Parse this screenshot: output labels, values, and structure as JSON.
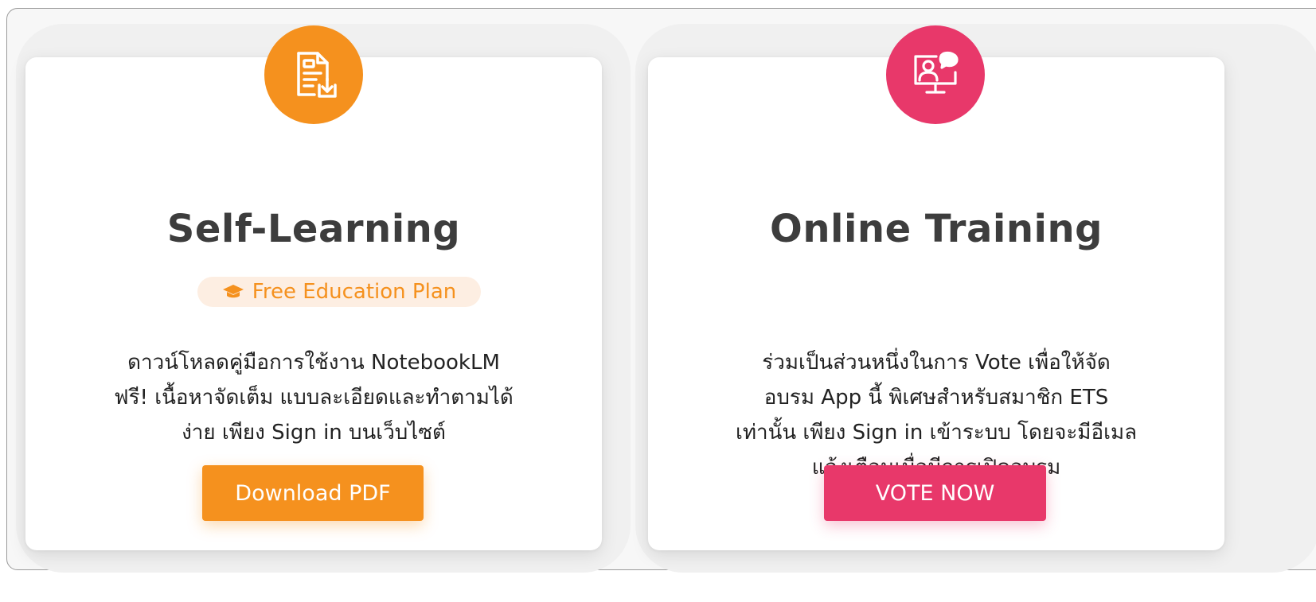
{
  "colors": {
    "orange": "#f5911e",
    "pink": "#e8386a",
    "title": "#3d3d3d"
  },
  "cards": [
    {
      "title": "Self-Learning",
      "icon": "document-download-icon",
      "badge": {
        "icon": "graduation-cap-icon",
        "label": "Free Education Plan"
      },
      "description": [
        "ดาวน์โหลดคู่มือการใช้งาน NotebookLM",
        "ฟรี! เนื้อหาจัดเต็ม แบบละเอียดและทำตามได้",
        "ง่าย เพียง Sign in บนเว็บไซต์"
      ],
      "button_label": "Download PDF"
    },
    {
      "title": "Online Training",
      "icon": "online-training-icon",
      "description": [
        "ร่วมเป็นส่วนหนึ่งในการ Vote เพื่อให้จัด",
        "อบรม App นี้ พิเศษสำหรับสมาชิก ETS",
        "เท่านั้น เพียง Sign in เข้าระบบ โดยจะมีอีเมล",
        "แจ้งเตือนเมื่อมีการเปิดอบรม"
      ],
      "button_label": "VOTE NOW"
    }
  ]
}
